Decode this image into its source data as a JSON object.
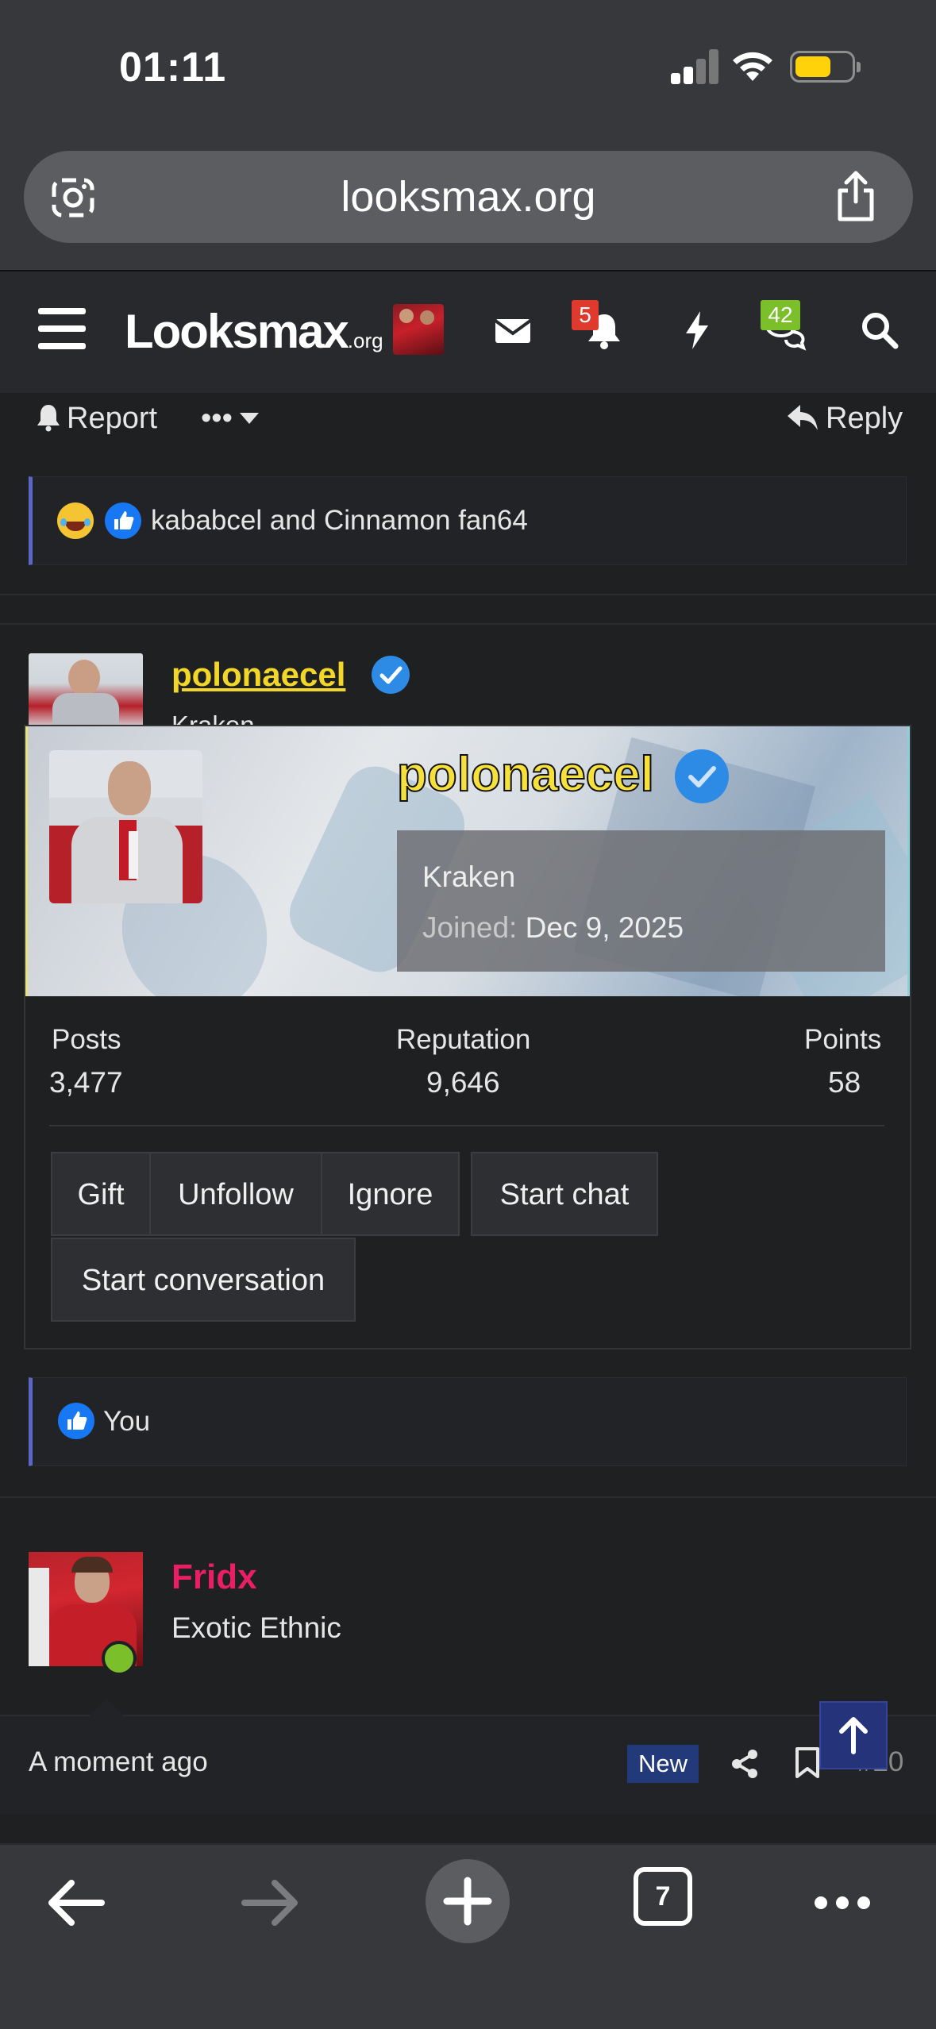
{
  "status_bar": {
    "time": "01:11"
  },
  "browser": {
    "url": "looksmax.org",
    "tab_count": "7"
  },
  "forum_header": {
    "logo_main": "Looksmax",
    "logo_suffix": ".org",
    "alerts_badge": "5",
    "conversations_badge": "42"
  },
  "post_actions": {
    "report": "Report",
    "more": "•••",
    "reply": "Reply"
  },
  "reactions_1": {
    "users": "kababcel and Cinnamon fan64"
  },
  "poster": {
    "name": "polonaecel",
    "title_peek": "Kraken"
  },
  "user_card": {
    "name": "polonaecel",
    "title": "Kraken",
    "joined_label": "Joined:",
    "joined_value": "Dec 9, 2025",
    "stats": [
      {
        "label": "Posts",
        "value": "3,477"
      },
      {
        "label": "Reputation",
        "value": "9,646"
      },
      {
        "label": "Points",
        "value": "58"
      }
    ],
    "buttons": {
      "gift": "Gift",
      "unfollow": "Unfollow",
      "ignore": "Ignore",
      "start_chat": "Start chat",
      "start_conversation": "Start conversation"
    }
  },
  "reactions_2": {
    "users": "You"
  },
  "next_post": {
    "name": "Fridx",
    "title": "Exotic Ethnic",
    "timestamp": "A moment ago",
    "new_label": "New",
    "number": "#20"
  },
  "colors": {
    "accent_blue": "#2d8be6",
    "username_yellow": "#f2d729",
    "username_pink": "#e91e63",
    "online_green": "#7bbf2a",
    "alert_red": "#e03a2f"
  }
}
